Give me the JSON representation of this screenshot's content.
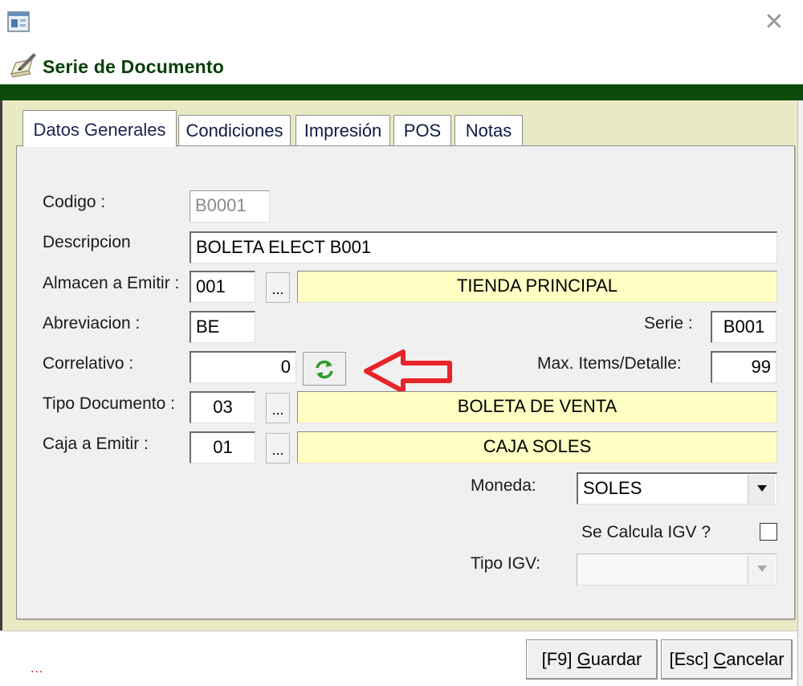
{
  "window": {
    "title": "Serie de Documento",
    "close_glyph": "✕",
    "accent_color": "#0b4b0b",
    "panel_color": "#e9e9c3",
    "highlight_color": "#ffffc3"
  },
  "tabs": [
    {
      "label": "Datos Generales",
      "active": true
    },
    {
      "label": "Condiciones",
      "active": false
    },
    {
      "label": "Impresión",
      "active": false
    },
    {
      "label": "POS",
      "active": false
    },
    {
      "label": "Notas",
      "active": false
    }
  ],
  "form": {
    "codigo": {
      "label": "Codigo :",
      "value": "B0001"
    },
    "descripcion": {
      "label": "Descripcion",
      "value": "BOLETA ELECT B001"
    },
    "almacen": {
      "label": "Almacen a Emitir :",
      "code": "001",
      "name": "TIENDA PRINCIPAL"
    },
    "abreviacion": {
      "label": "Abreviacion :",
      "value": "BE"
    },
    "serie": {
      "label": "Serie :",
      "value": "B001"
    },
    "correlativo": {
      "label": "Correlativo :",
      "value": "0"
    },
    "max_items": {
      "label": "Max. Items/Detalle:",
      "value": "99"
    },
    "tipo_documento": {
      "label": "Tipo Documento :",
      "code": "03",
      "name": "BOLETA DE VENTA"
    },
    "caja": {
      "label": "Caja a Emitir :",
      "code": "01",
      "name": "CAJA SOLES"
    },
    "moneda": {
      "label": "Moneda:",
      "value": "SOLES"
    },
    "calcula_igv": {
      "label": "Se Calcula IGV ?",
      "checked": false
    },
    "tipo_igv": {
      "label": "Tipo IGV:",
      "value": ""
    },
    "lookup_button": "..."
  },
  "footer": {
    "status_dots": "...",
    "guardar_prefix": "[F9] ",
    "guardar_key": "G",
    "guardar_rest": "uardar",
    "cancelar_prefix": "[Esc] ",
    "cancelar_key": "C",
    "cancelar_rest": "ancelar"
  },
  "icons": {
    "app": "app-window-icon",
    "header": "document-edit-icon",
    "refresh": "refresh-arrows-icon",
    "annotation": "red-arrow-left-annotation",
    "dropdown": "chevron-down-icon"
  }
}
